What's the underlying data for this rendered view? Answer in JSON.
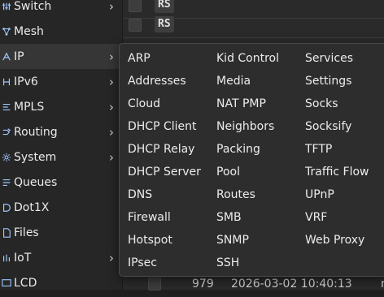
{
  "sidebar": {
    "items": [
      {
        "label": "Switch",
        "icon": "switch-icon",
        "chevron": "›"
      },
      {
        "label": "Mesh",
        "icon": "mesh-icon",
        "chevron": ""
      },
      {
        "label": "IP",
        "icon": "ip-icon",
        "chevron": "›"
      },
      {
        "label": "IPv6",
        "icon": "ipv6-icon",
        "chevron": "›"
      },
      {
        "label": "MPLS",
        "icon": "mpls-icon",
        "chevron": "›"
      },
      {
        "label": "Routing",
        "icon": "routing-icon",
        "chevron": "›"
      },
      {
        "label": "System",
        "icon": "gear-icon",
        "chevron": "›"
      },
      {
        "label": "Queues",
        "icon": "queues-icon",
        "chevron": ""
      },
      {
        "label": "Dot1X",
        "icon": "dot1x-icon",
        "chevron": ""
      },
      {
        "label": "Files",
        "icon": "file-icon",
        "chevron": ""
      },
      {
        "label": "IoT",
        "icon": "iot-icon",
        "chevron": "›"
      },
      {
        "label": "LCD",
        "icon": "lcd-icon",
        "chevron": ""
      }
    ]
  },
  "table": {
    "rows": [
      {
        "tag": "RS"
      },
      {
        "tag": "RS"
      }
    ],
    "bottom_row": {
      "number": "979",
      "datetime": "2026-03-02 10:40:13",
      "extra": "n"
    }
  },
  "menu": {
    "col1": [
      "ARP",
      "Addresses",
      "Cloud",
      "DHCP Client",
      "DHCP Relay",
      "DHCP Server",
      "DNS",
      "Firewall",
      "Hotspot",
      "IPsec"
    ],
    "col2": [
      "Kid Control",
      "Media",
      "NAT PMP",
      "Neighbors",
      "Packing",
      "Pool",
      "Routes",
      "SMB",
      "SNMP",
      "SSH"
    ],
    "col3": [
      "Services",
      "Settings",
      "Socks",
      "Socksify",
      "TFTP",
      "Traffic Flow",
      "UPnP",
      "VRF",
      "Web Proxy"
    ]
  },
  "colors": {
    "accent": "#9cc8ff",
    "menu_bg": "#2d2d2d",
    "sidebar_bg": "#262626"
  }
}
